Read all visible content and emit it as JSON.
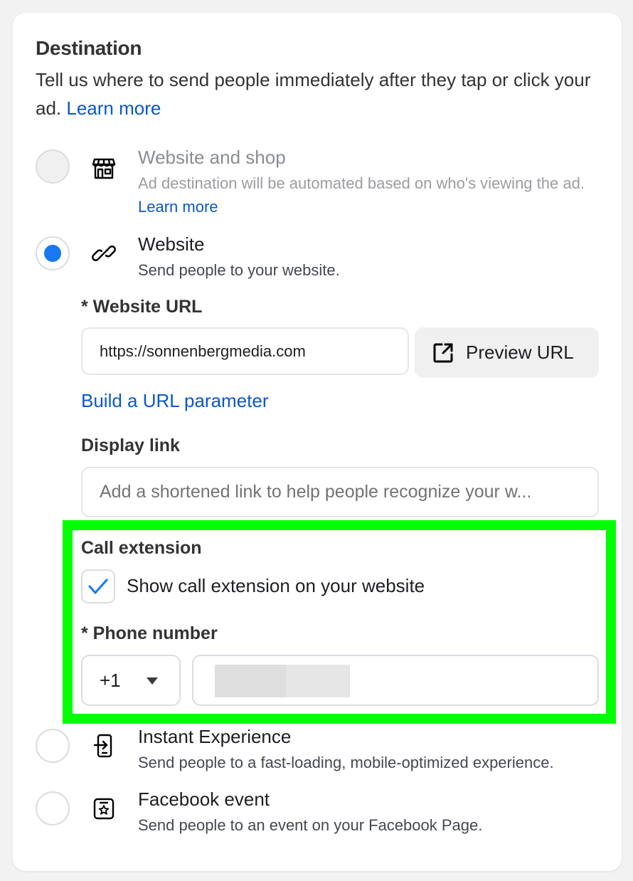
{
  "destination": {
    "title": "Destination",
    "description": "Tell us where to send people immediately after they tap or click your ad.",
    "learn_more": "Learn more"
  },
  "options": [
    {
      "id": "website-and-shop",
      "label": "Website and shop",
      "description": "Ad destination will be automated based on who's viewing the ad.",
      "learn_more": "Learn more",
      "icon": "shop-icon",
      "selected": false,
      "disabled": true
    },
    {
      "id": "website",
      "label": "Website",
      "description": "Send people to your website.",
      "icon": "link-icon",
      "selected": true,
      "disabled": false
    },
    {
      "id": "instant-experience",
      "label": "Instant Experience",
      "description": "Send people to a fast-loading, mobile-optimized experience.",
      "icon": "mobile-enter-icon",
      "selected": false,
      "disabled": false
    },
    {
      "id": "facebook-event",
      "label": "Facebook event",
      "description": "Send people to an event on your Facebook Page.",
      "icon": "event-star-icon",
      "selected": false,
      "disabled": false
    }
  ],
  "website_form": {
    "url_label": "* Website URL",
    "url_value": "https://sonnenbergmedia.com",
    "preview_button": "Preview URL",
    "build_param_link": "Build a URL parameter",
    "display_link_label": "Display link",
    "display_link_placeholder": "Add a shortened link to help people recognize your w..."
  },
  "call_extension": {
    "title": "Call extension",
    "checkbox_label": "Show call extension on your website",
    "checked": true,
    "phone_label": "* Phone number",
    "country_code": "+1",
    "phone_value_redacted": true
  },
  "colors": {
    "accent": "#1877f2",
    "link": "#0a58ca",
    "highlight": "#00ff00"
  }
}
